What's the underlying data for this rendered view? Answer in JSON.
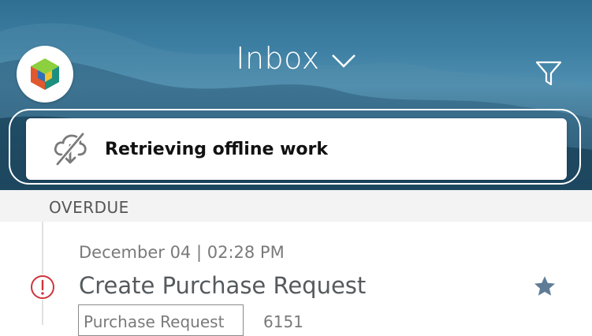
{
  "header": {
    "title": "Inbox",
    "banner_text": "Retrieving offline work"
  },
  "section": {
    "label": "OVERDUE"
  },
  "task": {
    "date": "December 04 | 02:28 PM",
    "title": "Create Purchase Request",
    "tag": "Purchase Request",
    "id": "6151"
  },
  "icons": {
    "logo": "app-logo-icon",
    "chevron": "chevron-down-icon",
    "filter": "filter-icon",
    "offline": "cloud-offline-icon",
    "alert": "alert-circle-icon",
    "star": "star-icon"
  },
  "colors": {
    "accent_star": "#5f7c97",
    "alert": "#d0343a"
  }
}
